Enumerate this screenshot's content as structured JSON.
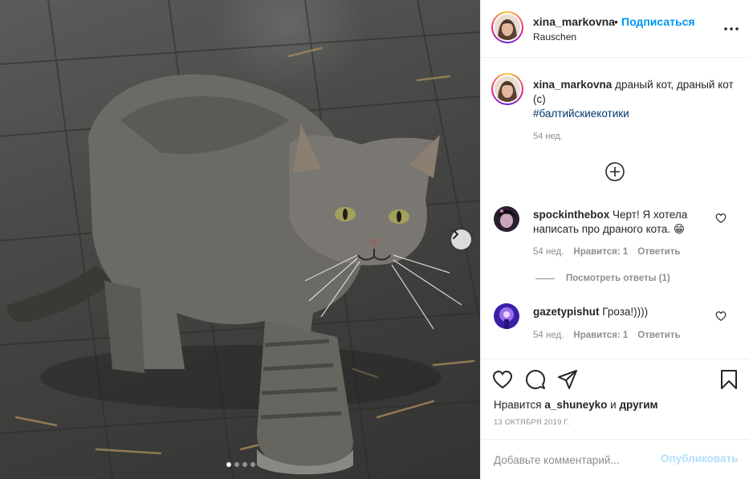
{
  "post": {
    "image_alt": "cat",
    "carousel": {
      "total_slides": 4,
      "active_slide": 1
    }
  },
  "header": {
    "username": "xina_markovna",
    "separator": "•",
    "follow_label": "Подписаться",
    "location": "Rauschen",
    "more_icon": "more-horizontal-icon"
  },
  "caption": {
    "username": "xina_markovna",
    "text": "драный кот, драный кот (с)",
    "hashtag": "#балтийскиекотики",
    "time": "54 нед."
  },
  "load_more_icon": "plus-circle-icon",
  "comments": [
    {
      "username": "spockinthebox",
      "text": "Черт! Я хотела написать про драного кота.",
      "emoji": "😁",
      "time": "54 нед.",
      "likes": "Нравится: 1",
      "reply": "Ответить",
      "view_replies": "Посмотреть ответы (1)"
    },
    {
      "username": "gazetypishut",
      "text": "Гроза!))))",
      "time": "54 нед.",
      "likes": "Нравится: 1",
      "reply": "Ответить"
    }
  ],
  "actions": {
    "like_icon": "heart-icon",
    "comment_icon": "comment-icon",
    "share_icon": "send-icon",
    "save_icon": "bookmark-icon",
    "likes_prefix": "Нравится",
    "likes_user": "a_shuneyko",
    "likes_and": "и",
    "likes_others": "другим",
    "date": "13 ОКТЯБРЯ 2019 Г."
  },
  "comment_box": {
    "placeholder": "Добавьте комментарий...",
    "publish_label": "Опубликовать"
  },
  "colors": {
    "accent": "#0095f6",
    "publish_disabled": "#b2dffc",
    "secondary_text": "#8e8e8e",
    "hashtag": "#00376b"
  }
}
